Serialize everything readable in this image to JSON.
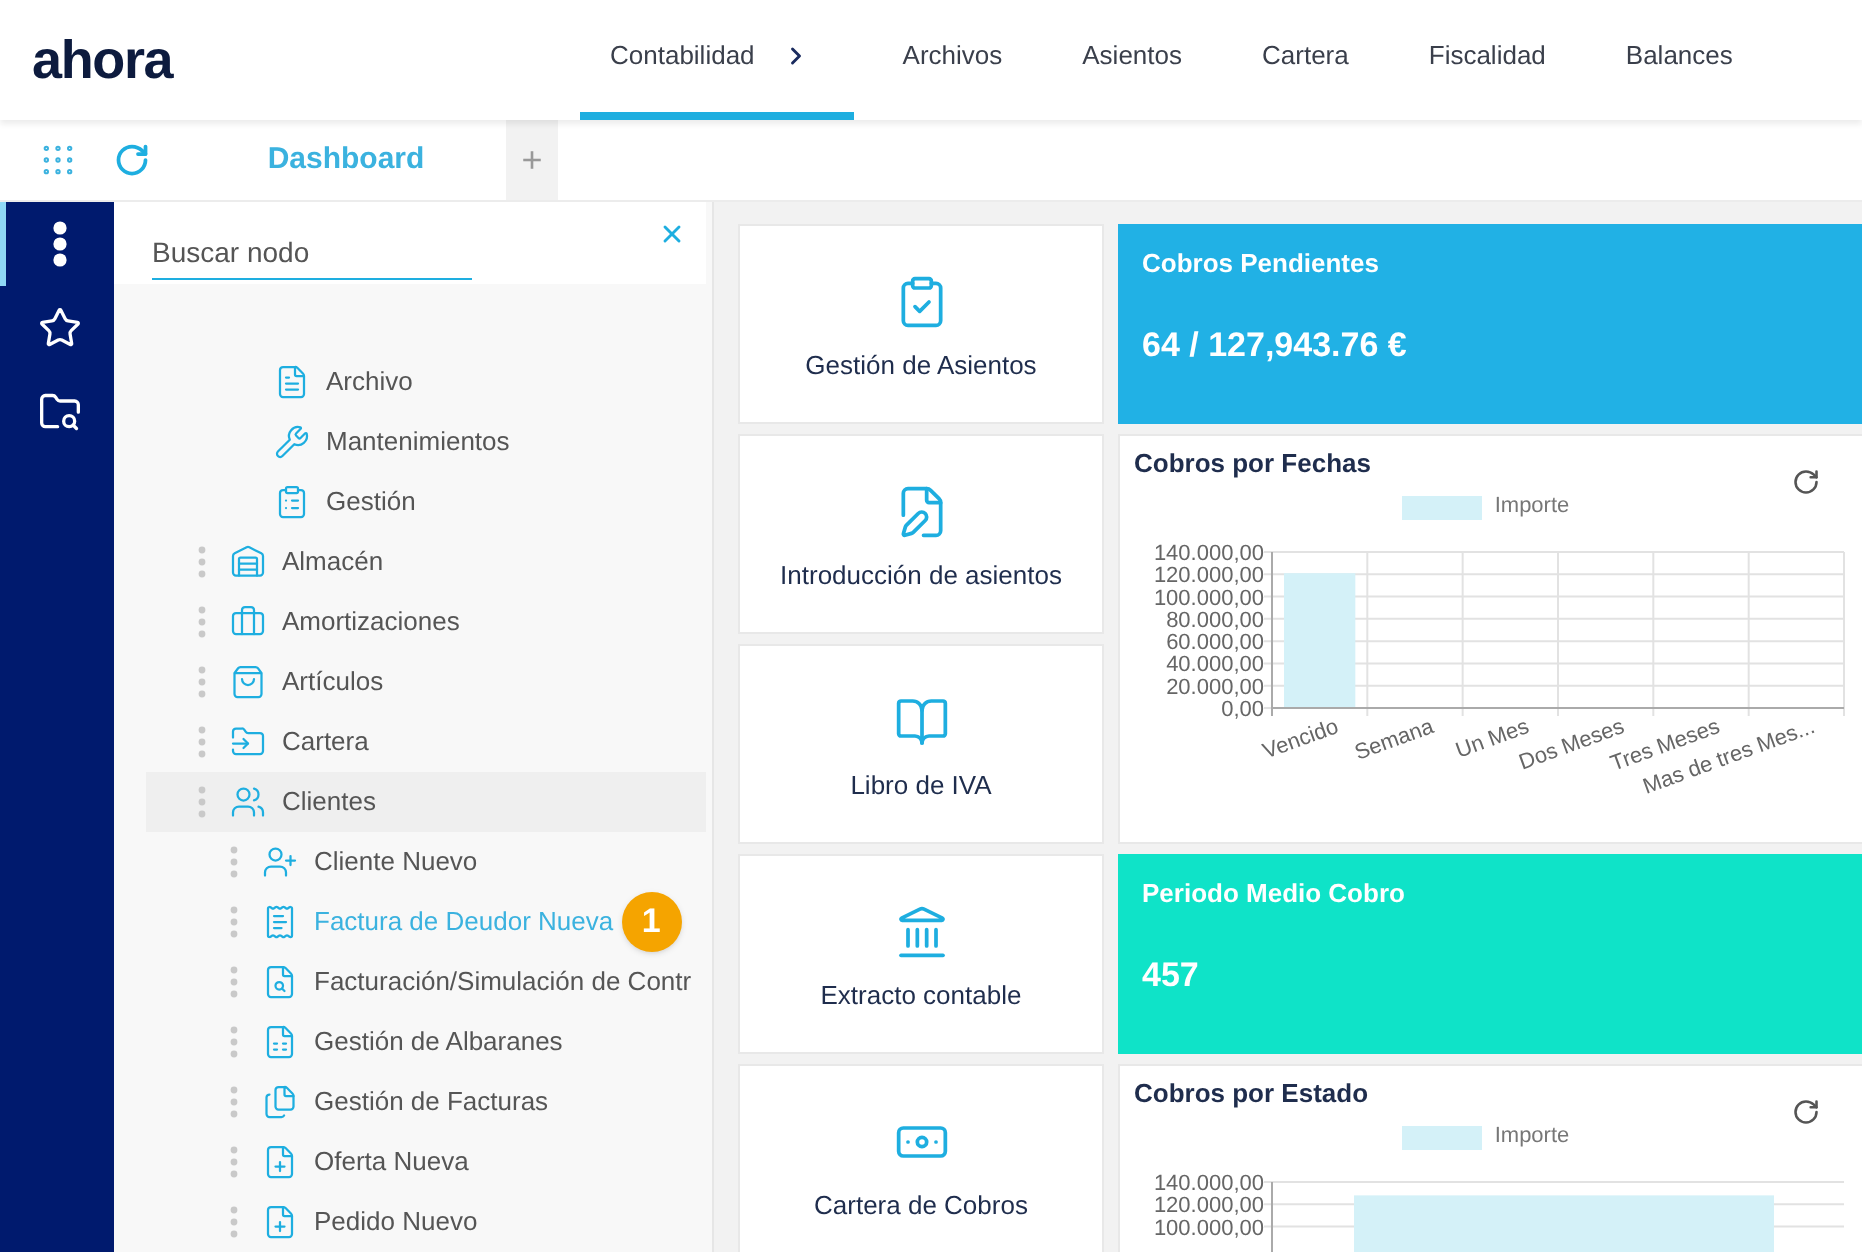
{
  "logo": "ahora",
  "nav": [
    {
      "label": "Contabilidad",
      "selected": true,
      "has_menu": true
    },
    {
      "label": "Archivos",
      "selected": false,
      "has_menu": false
    },
    {
      "label": "Asientos",
      "selected": false,
      "has_menu": false
    },
    {
      "label": "Cartera",
      "selected": false,
      "has_menu": false
    },
    {
      "label": "Fiscalidad",
      "selected": false,
      "has_menu": false
    },
    {
      "label": "Balances",
      "selected": false,
      "has_menu": false
    }
  ],
  "tabs": [
    {
      "label": "Dashboard",
      "selected": true
    }
  ],
  "add_tab": "+",
  "rail": [
    {
      "selected": true
    },
    {
      "selected": false
    },
    {
      "selected": false
    }
  ],
  "tree": {
    "search": {
      "placeholder": "Buscar nodo"
    },
    "items": [
      {
        "label": "Archivo",
        "selected": false,
        "active": false,
        "draggable": false
      },
      {
        "label": "Mantenimientos",
        "selected": false,
        "active": false,
        "draggable": false
      },
      {
        "label": "Gestión",
        "selected": false,
        "active": false,
        "draggable": false,
        "children": [
          {
            "label": "Almacén",
            "selected": false,
            "active": false,
            "draggable": true
          },
          {
            "label": "Amortizaciones",
            "selected": false,
            "active": false,
            "draggable": true
          },
          {
            "label": "Artículos",
            "selected": false,
            "active": false,
            "draggable": true
          },
          {
            "label": "Cartera",
            "selected": false,
            "active": false,
            "draggable": true
          },
          {
            "label": "Clientes",
            "selected": true,
            "active": false,
            "draggable": true,
            "children": [
              {
                "label": "Cliente Nuevo",
                "selected": false,
                "active": false,
                "draggable": true
              },
              {
                "label": "Factura de Deudor Nueva",
                "selected": false,
                "active": true,
                "draggable": true,
                "badge": "1"
              },
              {
                "label": "Facturación/Simulación de Contr",
                "selected": false,
                "active": false,
                "draggable": true
              },
              {
                "label": "Gestión de Albaranes",
                "selected": false,
                "active": false,
                "draggable": true
              },
              {
                "label": "Gestión de Facturas",
                "selected": false,
                "active": false,
                "draggable": true
              },
              {
                "label": "Oferta Nueva",
                "selected": false,
                "active": false,
                "draggable": true
              },
              {
                "label": "Pedido Nuevo",
                "selected": false,
                "active": false,
                "draggable": true
              }
            ]
          }
        ]
      }
    ]
  },
  "tiles": [
    {
      "label": "Gestión de Asientos"
    },
    {
      "label": "Introducción de asientos"
    },
    {
      "label": "Libro de IVA"
    },
    {
      "label": "Extracto contable"
    },
    {
      "label": "Cartera de Cobros"
    }
  ],
  "widgets": [
    {
      "kind": "kpi",
      "title": "Cobros Pendientes",
      "value": "64 / 127,943.76 €",
      "color": "#21b1e5"
    },
    {
      "kind": "chart",
      "title": "Cobros por Fechas",
      "chart_data": {
        "type": "bar",
        "categories": [
          "Vencido",
          "Semana",
          "Un Mes",
          "Dos Meses",
          "Tres Meses",
          "Mas de tres Mes..."
        ],
        "series": [
          {
            "name": "Importe",
            "color": "#d4f1f8",
            "values": [
              121000,
              0,
              null,
              null,
              0,
              0
            ]
          }
        ],
        "grid": true,
        "ylim": [
          0,
          140000
        ],
        "yticks": [
          {
            "value": 0,
            "label": "0,00"
          },
          {
            "value": 20000,
            "label": "20.000,00"
          },
          {
            "value": 40000,
            "label": "40.000,00"
          },
          {
            "value": 60000,
            "label": "60.000,00"
          },
          {
            "value": 80000,
            "label": "80.000,00"
          },
          {
            "value": 100000,
            "label": "100.000,00"
          },
          {
            "value": 120000,
            "label": "120.000,00"
          },
          {
            "value": 140000,
            "label": "140.000,00"
          }
        ]
      }
    },
    {
      "kind": "kpi",
      "title": "Periodo Medio Cobro",
      "value": "457",
      "color": "#0fe3c8"
    },
    {
      "kind": "chart",
      "title": "Cobros por Estado",
      "chart_data": {
        "type": "bar",
        "series": [
          {
            "name": "Importe",
            "color": "#d4f1f8",
            "values": [
              128000
            ]
          }
        ],
        "grid": true,
        "ylim": [
          0,
          140000
        ],
        "yticks": [
          {
            "value": 100000,
            "label": "100.000,00"
          },
          {
            "value": 120000,
            "label": "120.000,00"
          },
          {
            "value": 140000,
            "label": "140.000,00"
          }
        ]
      }
    }
  ]
}
